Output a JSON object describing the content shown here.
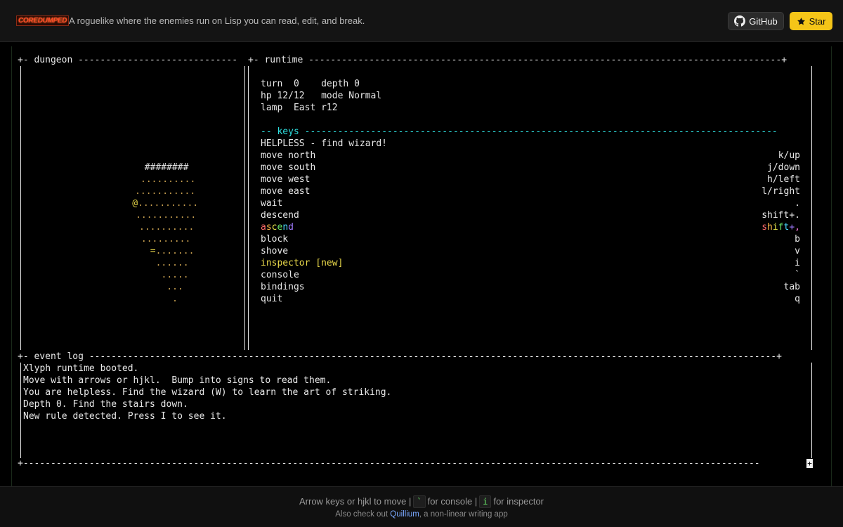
{
  "header": {
    "logo_text": "COREDUMPED",
    "tagline": "A roguelike where the enemies run on Lisp you can read, edit, and break.",
    "github_label": "GitHub",
    "star_label": "Star",
    "github_icon": "github-icon",
    "star_icon": "star-icon"
  },
  "dungeon": {
    "title": "dungeon",
    "map_rows": [
      {
        "text": "########",
        "kind": "hash"
      },
      {
        "text": "..........",
        "kind": "dot"
      },
      {
        "text": "...........",
        "kind": "dot"
      },
      {
        "text": "...........",
        "kind": "dot",
        "player": "@"
      },
      {
        "text": "...........",
        "kind": "dot"
      },
      {
        "text": "..........",
        "kind": "dot"
      },
      {
        "text": ".........",
        "kind": "dot"
      },
      {
        "text": ".......",
        "kind": "dot",
        "stairs": "="
      },
      {
        "text": "......",
        "kind": "dot"
      },
      {
        "text": ".....",
        "kind": "dot"
      },
      {
        "text": "...",
        "kind": "dot"
      },
      {
        "text": ".",
        "kind": "dot"
      }
    ]
  },
  "runtime": {
    "title": "runtime",
    "turn_label": "turn",
    "turn_value": "0",
    "depth_label": "depth",
    "depth_value": "0",
    "hp_label": "hp",
    "hp_value": "12/12",
    "mode_label": "mode",
    "mode_value": "Normal",
    "lamp_label": "lamp",
    "lamp_value": "East r12",
    "keys_title": "-- keys",
    "helpless_text": "HELPLESS - find wizard!",
    "bindings": [
      {
        "action": "move north",
        "key": "k/up"
      },
      {
        "action": "move south",
        "key": "j/down"
      },
      {
        "action": "move west",
        "key": "h/left"
      },
      {
        "action": "move east",
        "key": "l/right"
      },
      {
        "action": "wait",
        "key": "."
      },
      {
        "action": "descend",
        "key": "shift+."
      },
      {
        "action": "ascend",
        "key": "shift+,"
      },
      {
        "action": "block",
        "key": "b"
      },
      {
        "action": "shove",
        "key": "v"
      },
      {
        "action": "inspector [new]",
        "key": "i"
      },
      {
        "action": "console",
        "key": "`"
      },
      {
        "action": "bindings",
        "key": "tab"
      },
      {
        "action": "quit",
        "key": "q"
      }
    ]
  },
  "event_log": {
    "title": "event log",
    "lines": [
      "Xlyph runtime booted.",
      "Move with arrows or hjkl.  Bump into signs to read them.",
      "You are helpless. Find the wizard (W) to learn the art of striking.",
      "Depth 0. Find the stairs down.",
      "New rule detected. Press I to see it."
    ]
  },
  "footer": {
    "line1_a": "Arrow keys or hjkl to move |",
    "key_console": "`",
    "line1_b": "for console |",
    "key_inspector": "i",
    "line1_c": "for inspector",
    "line2_a": "Also check out",
    "line2_link": "Quillium",
    "line2_b": ", a non-linear writing app"
  },
  "colors": {
    "accent_star": "#f5c518",
    "keys_header": "#2ee0e0",
    "highlight": "#e8d84a",
    "floor": "#c8a050",
    "link": "#7aa8ff"
  }
}
